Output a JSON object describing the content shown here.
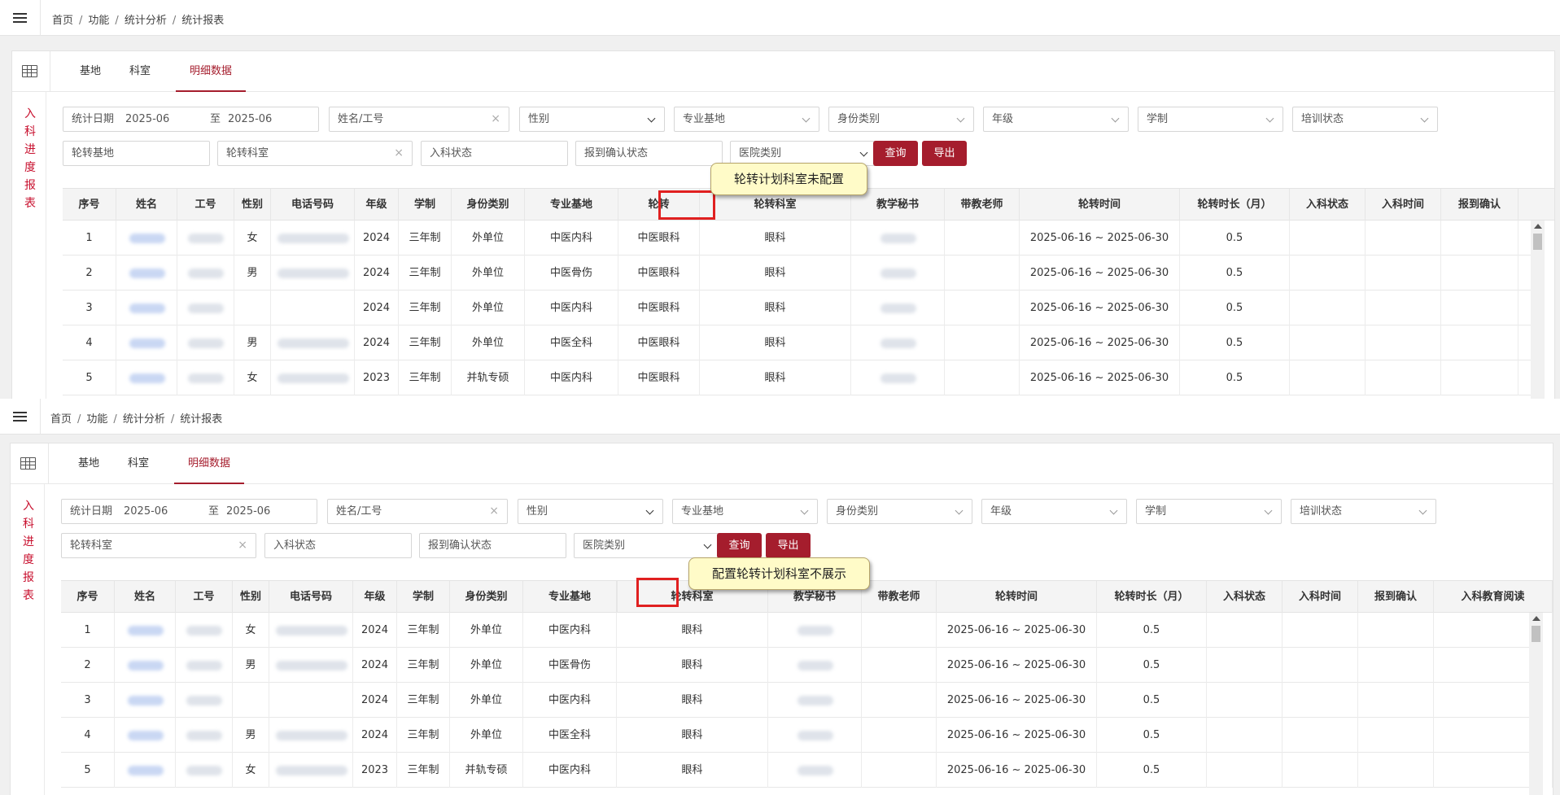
{
  "breadcrumb": [
    "首页",
    "功能",
    "统计分析",
    "统计报表"
  ],
  "tabs": [
    "基地",
    "科室",
    "明细数据"
  ],
  "sidebar_title": [
    "入",
    "科",
    "进",
    "度",
    "报",
    "表"
  ],
  "filters": {
    "date_label": "统计日期",
    "date_from": "2025-06",
    "date_to_label": "至",
    "date_to": "2025-06",
    "name_placeholder": "姓名/工号",
    "gender": "性别",
    "base": "专业基地",
    "identity": "身份类别",
    "grade": "年级",
    "system": "学制",
    "training_status": "培训状态",
    "rotation_base": "轮转基地",
    "rotation_dept": "轮转科室",
    "entry_status": "入科状态",
    "report_status": "报到确认状态",
    "hospital_type": "医院类别",
    "query": "查询",
    "export": "导出",
    "clear": "×"
  },
  "top": {
    "headers": [
      "序号",
      "姓名",
      "工号",
      "性别",
      "电话号码",
      "年级",
      "学制",
      "身份类别",
      "专业基地",
      "轮转",
      "轮转科室",
      "教学秘书",
      "带教老师",
      "轮转时间",
      "轮转时长（月）",
      "入科状态",
      "入科时间",
      "报到确认"
    ],
    "tooltip": "轮转计划科室未配置"
  },
  "bottom": {
    "headers": [
      "序号",
      "姓名",
      "工号",
      "性别",
      "电话号码",
      "年级",
      "学制",
      "身份类别",
      "专业基地",
      "",
      "轮转科室",
      "教学秘书",
      "带教老师",
      "轮转时间",
      "轮转时长（月）",
      "入科状态",
      "入科时间",
      "报到确认",
      "入科教育阅读"
    ],
    "tooltip": "配置轮转计划科室不展示"
  },
  "rows": [
    {
      "no": "1",
      "gender": "女",
      "grade": "2024",
      "system": "三年制",
      "identity": "外单位",
      "base": "中医内科",
      "rotation": "中医眼科",
      "dept": "眼科",
      "time": "2025-06-16 ~ 2025-06-30",
      "months": "0.5"
    },
    {
      "no": "2",
      "gender": "男",
      "grade": "2024",
      "system": "三年制",
      "identity": "外单位",
      "base": "中医骨伤",
      "rotation": "中医眼科",
      "dept": "眼科",
      "time": "2025-06-16 ~ 2025-06-30",
      "months": "0.5"
    },
    {
      "no": "3",
      "gender": "",
      "grade": "2024",
      "system": "三年制",
      "identity": "外单位",
      "base": "中医内科",
      "rotation": "中医眼科",
      "dept": "眼科",
      "time": "2025-06-16 ~ 2025-06-30",
      "months": "0.5"
    },
    {
      "no": "4",
      "gender": "男",
      "grade": "2024",
      "system": "三年制",
      "identity": "外单位",
      "base": "中医全科",
      "rotation": "中医眼科",
      "dept": "眼科",
      "time": "2025-06-16 ~ 2025-06-30",
      "months": "0.5"
    },
    {
      "no": "5",
      "gender": "女",
      "grade": "2023",
      "system": "三年制",
      "identity": "并轨专硕",
      "base": "中医内科",
      "rotation": "中医眼科",
      "dept": "眼科",
      "time": "2025-06-16 ~ 2025-06-30",
      "months": "0.5"
    }
  ],
  "colors": {
    "accent": "#a51d2d",
    "sidebar_text": "#c8102e",
    "highlight": "#e02020",
    "tooltip_bg": "#fffbc8"
  }
}
